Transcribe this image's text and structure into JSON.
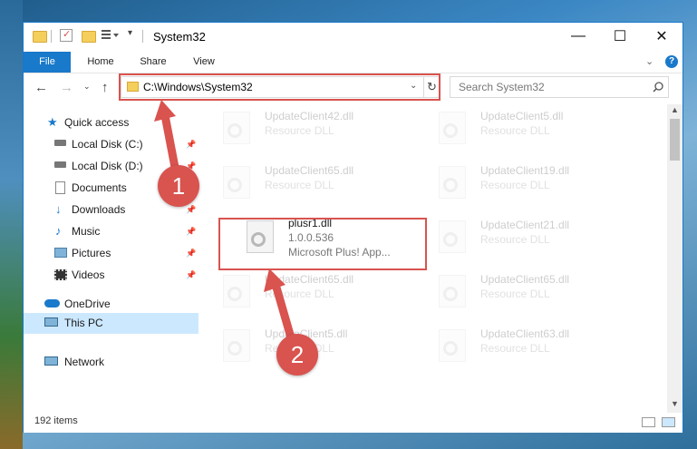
{
  "window": {
    "title": "System32"
  },
  "title_buttons": {
    "minimize": "—",
    "maximize": "☐",
    "close": "✕"
  },
  "ribbon": {
    "tabs": [
      "File",
      "Home",
      "Share",
      "View"
    ]
  },
  "address": {
    "path": "C:\\Windows\\System32",
    "search_placeholder": "Search System32"
  },
  "sidebar": {
    "items": [
      {
        "label": "Quick access"
      },
      {
        "label": "Local Disk (C:)"
      },
      {
        "label": "Local Disk (D:)"
      },
      {
        "label": "Documents"
      },
      {
        "label": "Downloads"
      },
      {
        "label": "Music"
      },
      {
        "label": "Pictures"
      },
      {
        "label": "Videos"
      },
      {
        "label": "OneDrive"
      },
      {
        "label": "This PC"
      },
      {
        "label": "Network"
      }
    ]
  },
  "files": [
    {
      "name": "UpdateClient42.dll",
      "desc": "Resource DLL"
    },
    {
      "name": "UpdateClient5.dll",
      "desc": "Resource DLL"
    },
    {
      "name": "UpdateClient65.dll",
      "desc": "Resource DLL"
    },
    {
      "name": "UpdateClient19.dll",
      "desc": "Resource DLL"
    },
    {
      "name": "plusr1.dll",
      "desc": "1.0.0.536",
      "desc2": "Microsoft Plus! App..."
    },
    {
      "name": "UpdateClient21.dll",
      "desc": "Resource DLL"
    },
    {
      "name": "UpdateClient65.dll",
      "desc": "Resource DLL"
    },
    {
      "name": "UpdateClient65.dll",
      "desc": "Resource DLL"
    },
    {
      "name": "UpdateClient5.dll",
      "desc": "Resource DLL"
    },
    {
      "name": "UpdateClient63.dll",
      "desc": "Resource DLL"
    }
  ],
  "status": {
    "items": "192 items"
  },
  "annotations": {
    "step1": "1",
    "step2": "2"
  },
  "colors": {
    "accent": "#1979ca",
    "highlight": "#d9534f",
    "selected": "#cce8ff"
  }
}
